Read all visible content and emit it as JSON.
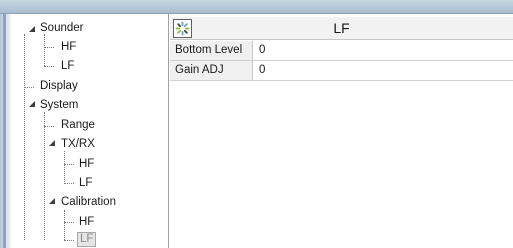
{
  "tree": {
    "items": [
      {
        "label": "Sounder"
      },
      {
        "label": "HF"
      },
      {
        "label": "LF"
      },
      {
        "label": "Display"
      },
      {
        "label": "System"
      },
      {
        "label": "Range"
      },
      {
        "label": "TX/RX"
      },
      {
        "label": "HF"
      },
      {
        "label": "LF"
      },
      {
        "label": "Calibration"
      },
      {
        "label": "HF"
      },
      {
        "label": "LF"
      }
    ]
  },
  "panel": {
    "title": "LF",
    "settings_icon": "gear-icon",
    "rows": [
      {
        "label": "Bottom Level",
        "value": "0"
      },
      {
        "label": "Gain ADJ",
        "value": "0"
      }
    ]
  }
}
